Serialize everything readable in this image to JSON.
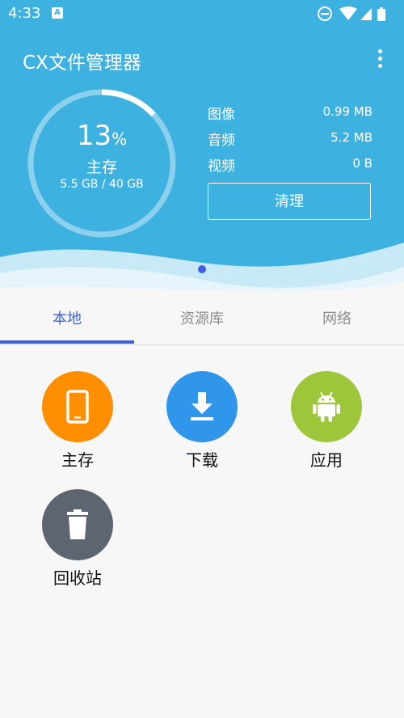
{
  "statusbar": {
    "time": "4:33",
    "notification_icon": "A"
  },
  "app": {
    "title": "CX文件管理器"
  },
  "storage": {
    "percent_used": 13,
    "percent_number": "13",
    "percent_sign": "%",
    "label": "主存",
    "detail": "5.5 GB / 40 GB"
  },
  "stats": [
    {
      "name": "图像",
      "value": "0.99 MB"
    },
    {
      "name": "音频",
      "value": "5.2 MB"
    },
    {
      "name": "视频",
      "value": "0 B"
    }
  ],
  "clean_button": {
    "label": "清理"
  },
  "tabs": [
    {
      "label": "本地",
      "active": true
    },
    {
      "label": "资源库",
      "active": false
    },
    {
      "label": "网络",
      "active": false
    }
  ],
  "grid": [
    {
      "label": "主存",
      "icon": "tablet-icon",
      "color": "#ff8f00"
    },
    {
      "label": "下载",
      "icon": "download-icon",
      "color": "#2f96ec"
    },
    {
      "label": "应用",
      "icon": "android-icon",
      "color": "#9dc73b"
    },
    {
      "label": "回收站",
      "icon": "trash-icon",
      "color": "#5d6670"
    }
  ],
  "colors": {
    "header_bg": "#3db1df",
    "accent": "#3f5ee0",
    "text_white": "#ffffff"
  }
}
